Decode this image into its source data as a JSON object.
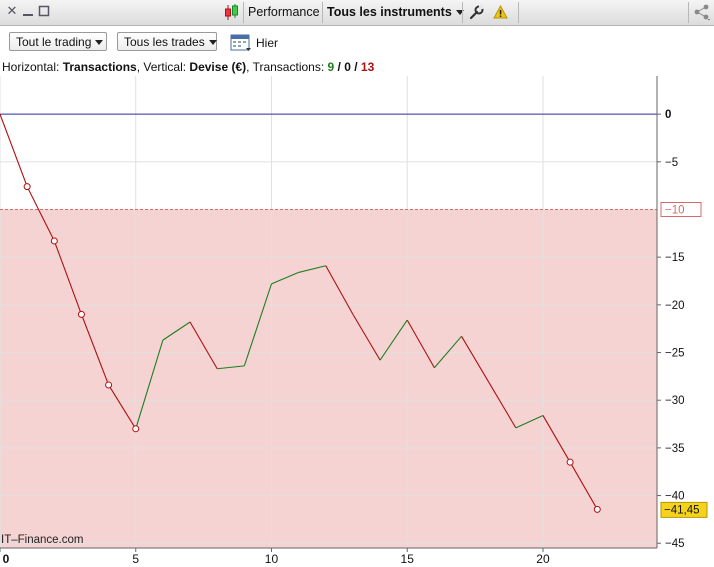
{
  "titlebar": {
    "performance_label": "Performance",
    "instruments_label": "Tous les instruments",
    "icons": [
      "close-icon",
      "minimize-icon",
      "maximize-icon",
      "candlestick-icon",
      "wrench-icon",
      "warning-icon",
      "share-icon"
    ]
  },
  "toolbar": {
    "trading_filter": "Tout le trading",
    "trades_filter": "Tous les trades",
    "date_label": "Hier"
  },
  "info": {
    "horizontal_prefix": "Horizontal: ",
    "horizontal_value": "Transactions",
    "vertical_prefix": ", Vertical: ",
    "vertical_value": "Devise (€)",
    "transactions_prefix": ", Transactions: ",
    "win_count": "9",
    "sep1": " / ",
    "even_count": "0",
    "sep2": " / ",
    "loss_count": "13"
  },
  "watermark": "IT–Finance.com",
  "colors": {
    "up": "#1e7d1e",
    "down": "#b01010",
    "zero_line": "#2a2aa8",
    "loss_zone": "#f5d3d3",
    "threshold": "#d46a6a",
    "current_badge": "#f5d21b"
  },
  "chart_data": {
    "type": "line",
    "x_ticks": [
      0,
      5,
      10,
      15,
      20
    ],
    "y_ticks": [
      0,
      -5,
      -10,
      -15,
      -20,
      -25,
      -30,
      -35,
      -40,
      -45
    ],
    "y_tick_labels": [
      "0",
      "−5",
      "−10",
      "−15",
      "−20",
      "−25",
      "−30",
      "−35",
      "−40",
      "−45"
    ],
    "xlim": [
      0,
      24.2
    ],
    "ylim": [
      -45.5,
      4
    ],
    "grid": true,
    "threshold": -10,
    "threshold_label": "−10",
    "current_value": -41.45,
    "current_label": "−41,45",
    "x": [
      0,
      1,
      2,
      3,
      4,
      5,
      6,
      7,
      8,
      9,
      10,
      11,
      12,
      13,
      14,
      15,
      16,
      17,
      18,
      19,
      20,
      21,
      22
    ],
    "values": [
      0,
      -7.6,
      -13.3,
      -21,
      -28.4,
      -33,
      -23.7,
      -21.8,
      -26.7,
      -26.4,
      -17.8,
      -16.6,
      -15.9,
      -21,
      -25.8,
      -21.6,
      -26.6,
      -23.3,
      -28.1,
      -32.9,
      -31.6,
      -36.5,
      -41.45
    ],
    "markers": [
      1,
      2,
      3,
      4,
      5,
      21,
      22
    ]
  }
}
